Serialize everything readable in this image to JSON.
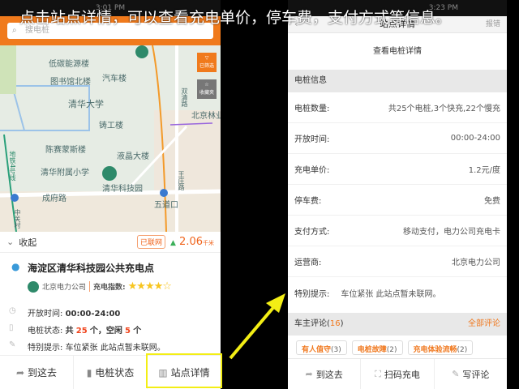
{
  "caption": "点击站点详情，可以查看充电单价，停车费，支付方式等信息。",
  "left": {
    "status_time": "3:01 PM",
    "search_placeholder": "搜电桩",
    "map": {
      "labels": [
        "低碳能源楼",
        "图书馆北楼",
        "汽车楼",
        "清华大学",
        "铸工楼",
        "陈赛蒙斯楼",
        "液晶大楼",
        "清华附属小学",
        "清华科技园",
        "成府路",
        "五道口",
        "双清路",
        "北京林业",
        "王庄路",
        "地铁4号线",
        "中关村"
      ],
      "filter_label": "已筛选",
      "favorites_label": "收藏夹"
    },
    "collapse_label": "收起",
    "online_badge": "已联网",
    "distance": "2.06",
    "distance_unit": "千米",
    "station_name": "海淀区清华科技园公共充电点",
    "operator": "北京电力公司",
    "charge_index_label": "充电指数:",
    "rating": 4,
    "rating_max": 5,
    "open_label": "开放时间:",
    "open_value": "00:00-24:00",
    "pile_label": "电桩状态:",
    "pile_total_prefix": "共",
    "pile_total": "25",
    "pile_mid": "个，空闲",
    "pile_free": "5",
    "pile_suffix": "个",
    "note_label": "特别提示:",
    "note_value": "车位紧张 此站点暂未联网。",
    "actions": [
      "到这去",
      "电桩状态",
      "站点详情"
    ]
  },
  "right": {
    "status_time": "3:23 PM",
    "title": "站点详情",
    "report": "报错",
    "view_piles": "查看电桩详情",
    "section": "电桩信息",
    "rows": [
      {
        "label": "电桩数量:",
        "value": "共25个电桩,3个快充,22个慢充"
      },
      {
        "label": "开放时间:",
        "value": "00:00-24:00"
      },
      {
        "label": "充电单价:",
        "value": "1.2元/度"
      },
      {
        "label": "停车费:",
        "value": "免费"
      },
      {
        "label": "支付方式:",
        "value": "移动支付，电力公司充电卡"
      },
      {
        "label": "运营商:",
        "value": "北京电力公司"
      },
      {
        "label": "特别提示:",
        "value": "车位紧张 此站点暂未联网。"
      }
    ],
    "reviews_label": "车主评论(",
    "reviews_count": "16",
    "reviews_close": ")",
    "all_reviews": "全部评论",
    "tags": [
      {
        "name": "有人值守",
        "count": "(3)"
      },
      {
        "name": "电桩故障",
        "count": "(2)"
      },
      {
        "name": "充电体验流畅",
        "count": "(2)"
      }
    ],
    "actions": [
      "到这去",
      "扫码充电",
      "写评论"
    ]
  },
  "colors": {
    "accent": "#f0781e",
    "highlight": "#f3ee15"
  }
}
